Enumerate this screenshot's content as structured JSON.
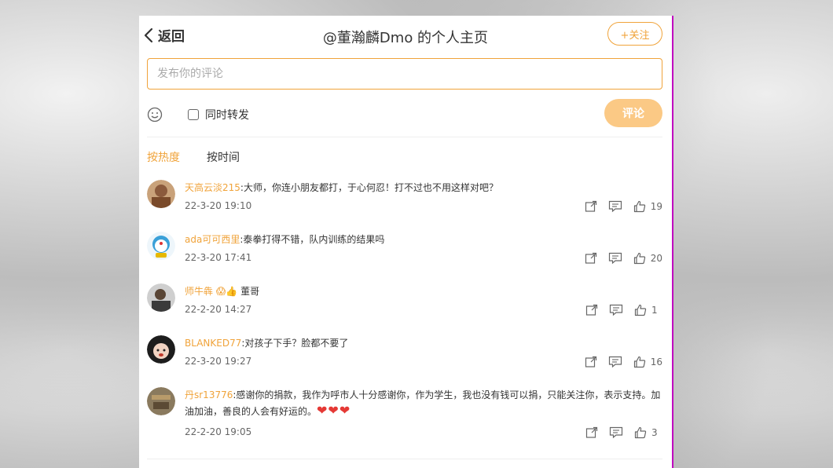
{
  "header": {
    "back_label": "返回",
    "title": "@董瀚麟Dmo 的个人主页",
    "follow_label": "+关注"
  },
  "composer": {
    "placeholder": "发布你的评论",
    "repost_label": "同时转发",
    "submit_label": "评论"
  },
  "sort_tabs": {
    "hot": "按热度",
    "time": "按时间"
  },
  "colors": {
    "accent": "#f0a33a",
    "submit_bg": "#fbc985",
    "text": "#333333",
    "meta": "#666666",
    "border_right": "#c000c0"
  },
  "comments": [
    {
      "user": "天高云淡215",
      "text": ":大师，你连小朋友都打，于心何忍！打不过也不用这样对吧？",
      "time": "22-3-20 19:10",
      "likes": "19"
    },
    {
      "user": "ada可可西里",
      "text": ":泰拳打得不错，队内训练的结果吗",
      "time": "22-3-20 17:41",
      "likes": "20"
    },
    {
      "user": "师牛犇",
      "text": " 董哥",
      "emoji": "😱👍",
      "time": "22-2-20 14:27",
      "likes": "1"
    },
    {
      "user": "BLANKED77",
      "text": ":对孩子下手？脸都不要了",
      "time": "22-3-20 19:27",
      "likes": "16"
    },
    {
      "user": "丹sr13776",
      "text": ":感谢你的捐款，我作为呼市人十分感谢你，作为学生，我也没有钱可以捐，只能关注你，表示支持。加油加油，善良的人会有好运的。",
      "hearts": "❤❤❤",
      "time": "22-2-20 19:05",
      "likes": "3"
    }
  ]
}
